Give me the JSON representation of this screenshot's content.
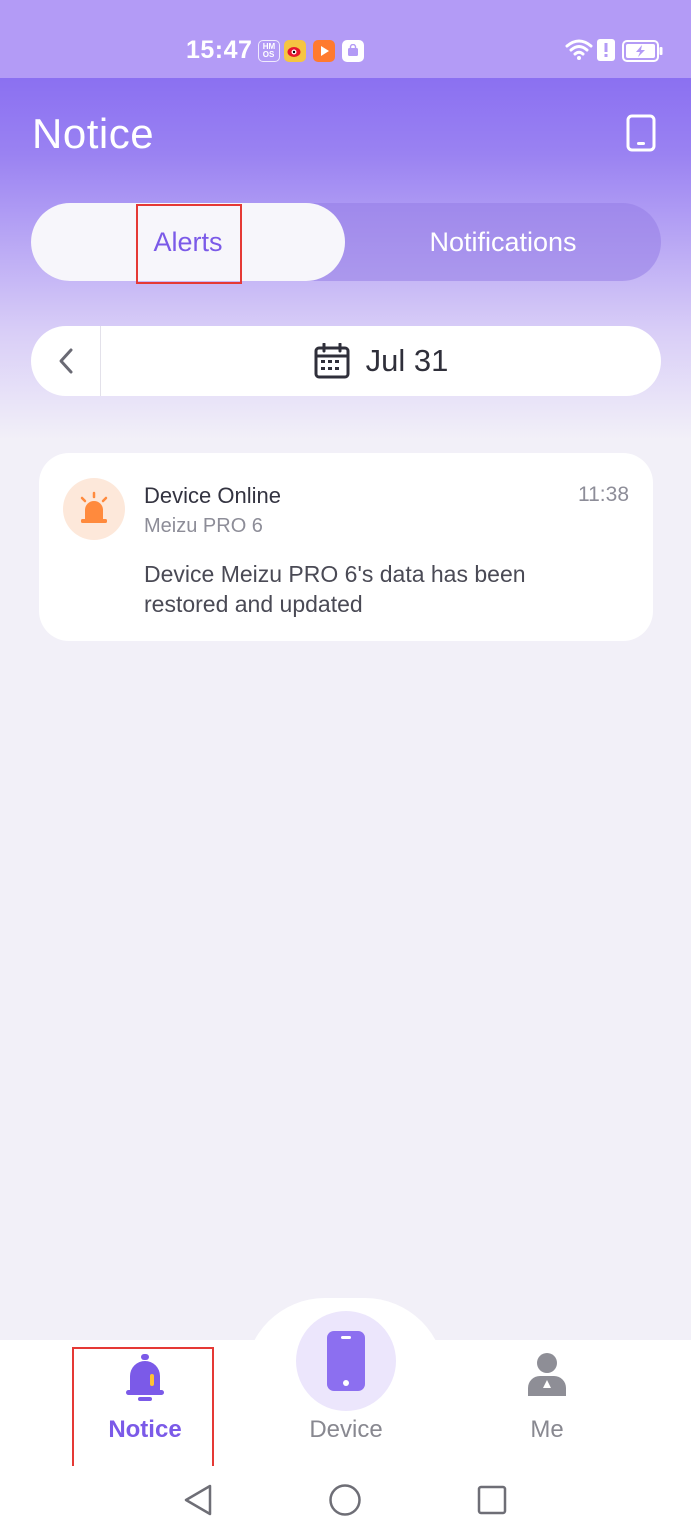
{
  "status_bar": {
    "time": "15:47",
    "left_icons": [
      "hmos-icon",
      "weibo-icon",
      "video-app-icon",
      "shop-app-icon"
    ],
    "right_icons": [
      "wifi-icon",
      "alert-status-icon",
      "battery-charging-icon"
    ]
  },
  "header": {
    "title": "Notice",
    "device_icon": "phone-outline-icon"
  },
  "tabs": {
    "alerts": "Alerts",
    "notifications": "Notifications",
    "active": "alerts"
  },
  "date_bar": {
    "date": "Jul 31",
    "calendar_icon": "calendar-icon",
    "prev_icon": "chevron-left-icon"
  },
  "alerts": [
    {
      "title": "Device Online",
      "device": "Meizu PRO 6",
      "time": "11:38",
      "body": "Device Meizu PRO 6's data has been restored and updated",
      "icon": "siren-icon"
    }
  ],
  "bottom_nav": {
    "notice": "Notice",
    "device": "Device",
    "me": "Me",
    "active": "notice"
  },
  "colors": {
    "accent": "#7b5ae8",
    "alert_orange": "#ff8a3d",
    "highlight": "#e53935"
  }
}
